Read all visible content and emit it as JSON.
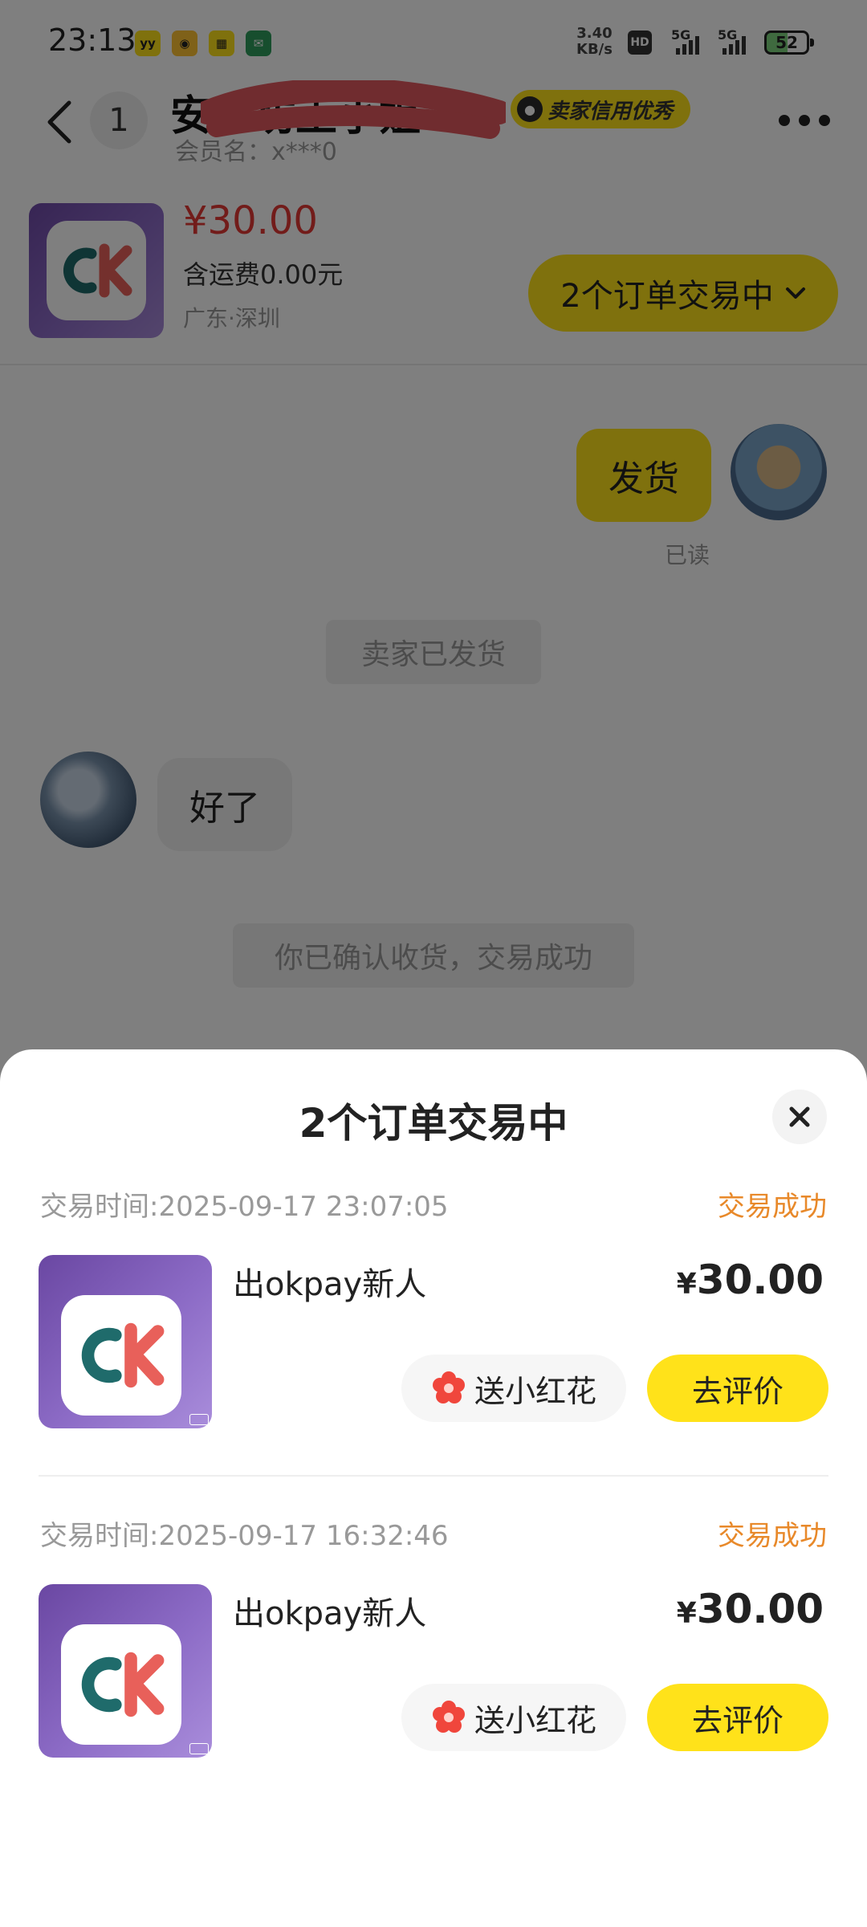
{
  "status_bar": {
    "time": "23:13",
    "net_speed_value": "3.40",
    "net_speed_unit": "KB/s",
    "hd_label": "HD",
    "net1": "5G",
    "net2": "5G",
    "battery": "52",
    "app_icons": [
      "yy",
      "game",
      "tool",
      "map"
    ]
  },
  "header": {
    "unread_count": "1",
    "seller_name": "安仁坊王小姐",
    "credit_badge": "卖家信用优秀",
    "member_name": "会员名：x***0",
    "icons": [
      "back-icon",
      "more-icon"
    ]
  },
  "product": {
    "price": "¥30.00",
    "shipping": "含运费0.00元",
    "location": "广东·深圳",
    "orders_pill": "2个订单交易中",
    "logo_text": "CK"
  },
  "chat": {
    "bubble_seller": "发货",
    "read_mark": "已读",
    "system_shipped": "卖家已发货",
    "bubble_buyer": "好了",
    "system_done": "你已确认收货，交易成功"
  },
  "sheet": {
    "title": "2个订单交易中",
    "orders": [
      {
        "time": "交易时间:2025-09-17 23:07:05",
        "status": "交易成功",
        "name": "出okpay新人",
        "price_symbol": "¥",
        "price": "30.00",
        "flower_label": "送小红花",
        "review_label": "去评价"
      },
      {
        "time": "交易时间:2025-09-17 16:32:46",
        "status": "交易成功",
        "name": "出okpay新人",
        "price_symbol": "¥",
        "price": "30.00",
        "flower_label": "送小红花",
        "review_label": "去评价"
      }
    ]
  },
  "colors": {
    "accent_yellow": "#ffe21a",
    "price_red": "#e53935",
    "status_orange": "#e8892a",
    "thumb_purple": "#7a56b8"
  }
}
